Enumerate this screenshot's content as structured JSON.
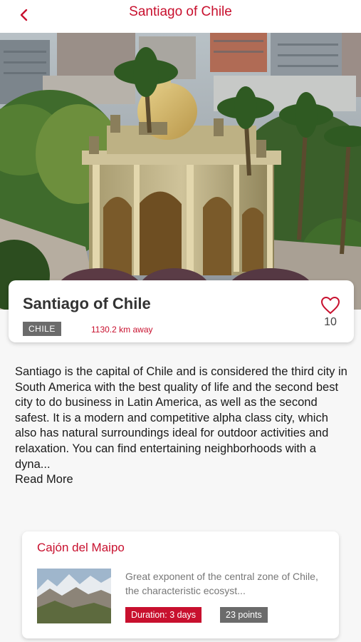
{
  "nav": {
    "title": "Santiago of Chile",
    "back_icon": "chevron-left-icon"
  },
  "hero": {
    "image": "Palacio-style pavilion on Santa Lucia hill with palm trees and city buildings",
    "slide_count": 5,
    "active_slide": 1
  },
  "place": {
    "name": "Santiago of Chile",
    "country": "CHILE",
    "distance": "1130.2 km away",
    "likes": "10",
    "like_icon": "heart-outline-icon"
  },
  "description": {
    "text": "Santiago is the capital of Chile and is considered the third city in South America with the best quality of life and the second best city to do business in Latin America, as well as the second safest. It is a modern and competitive alpha class city, which also has natural surroundings ideal for outdoor activities and relaxation. You can find entertaining neighborhoods with a dyna...",
    "read_more": "Read More"
  },
  "routes": [
    {
      "title": "Cajón del Maipo",
      "description": "Great exponent of the central zone of Chile, the characteristic ecosyst...",
      "duration": "Duration: 3 days",
      "points": "23 points"
    }
  ],
  "colors": {
    "accent": "#c8102e",
    "tag_gray": "#6b6b6b"
  }
}
